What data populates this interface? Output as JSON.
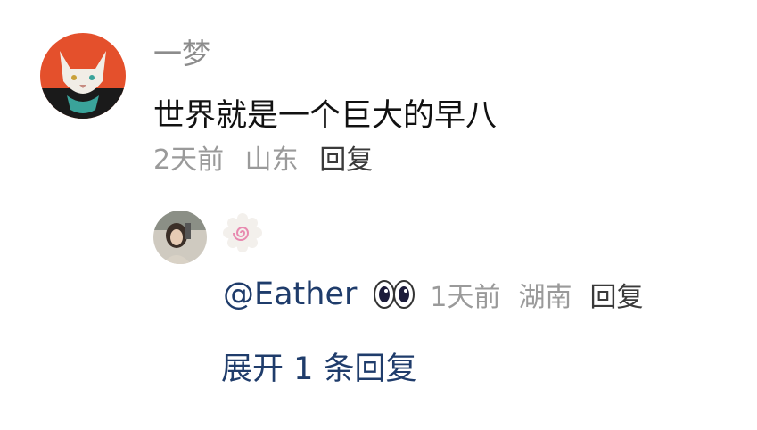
{
  "comment": {
    "username": "一梦",
    "text": "世界就是一个巨大的早八",
    "time": "2天前",
    "location": "山东",
    "reply_label": "回复"
  },
  "reply": {
    "mention": "@Eather",
    "emoji": "eyes-emoji",
    "time": "1天前",
    "location": "湖南",
    "reply_label": "回复"
  },
  "expand_label": "展开 1 条回复",
  "colors": {
    "link": "#1f3c6b",
    "meta": "#9a9a9a",
    "text": "#111111",
    "avatar_bg": "#e4502c"
  }
}
